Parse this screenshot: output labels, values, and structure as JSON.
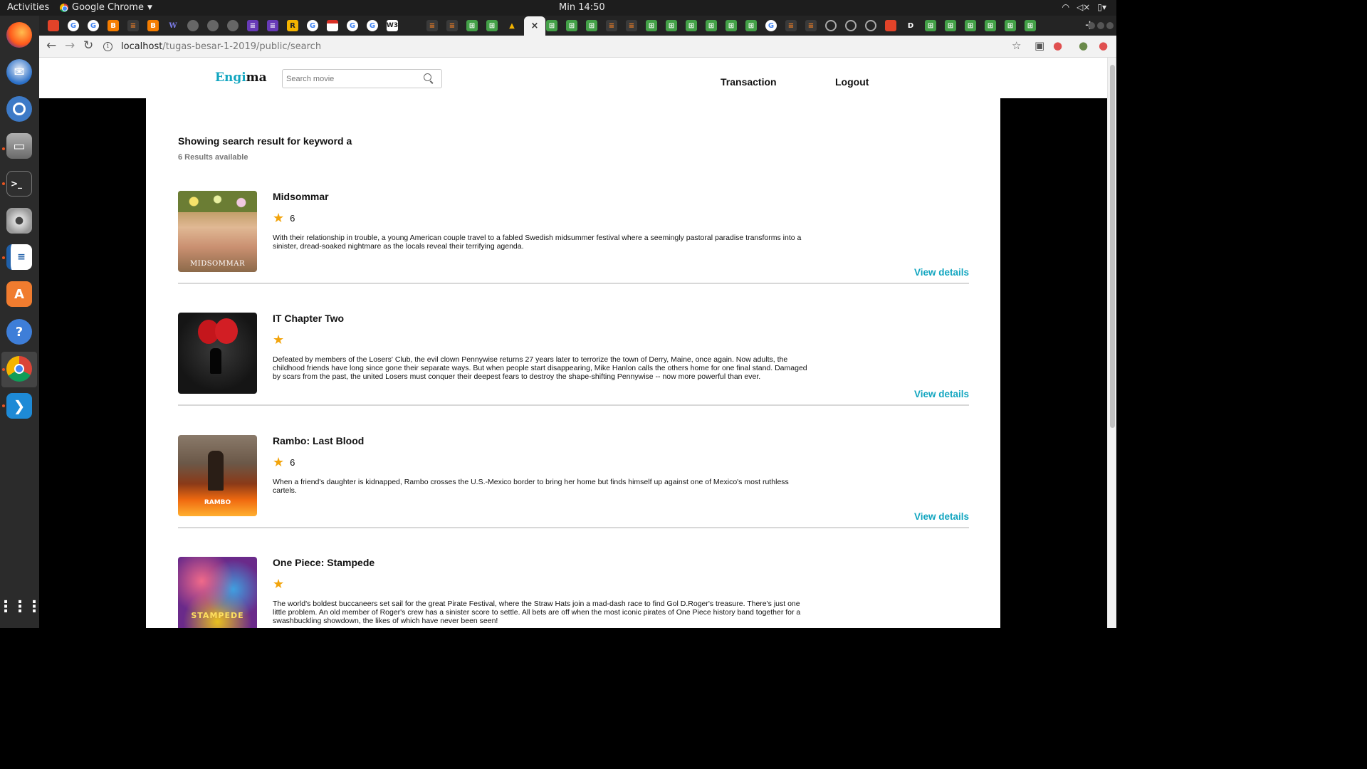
{
  "system": {
    "activities_label": "Activities",
    "app_name": "Google Chrome",
    "clock": "Min 14:50"
  },
  "browser": {
    "url_host": "localhost",
    "url_path": "/tugas-besar-1-2019/public/search",
    "tab_close_glyph": "×",
    "new_tab_glyph": "+"
  },
  "site": {
    "logo_part1": "Engi",
    "logo_part2": "ma",
    "search_placeholder": "Search movie",
    "nav": {
      "transaction": "Transaction",
      "logout": "Logout"
    },
    "accent_color": "#13a6c0",
    "star_color": "#f2a40c"
  },
  "results": {
    "title": "Showing search result for keyword a",
    "count": "6 Results available",
    "view_details_label": "View details",
    "movies": [
      {
        "title": "Midsommar",
        "rating": "6",
        "poster_text": "MIDSOMMAR",
        "description": "With their relationship in trouble, a young American couple travel to a fabled Swedish midsummer festival where a seemingly pastoral paradise transforms into a sinister, dread-soaked nightmare as the locals reveal their terrifying agenda."
      },
      {
        "title": "IT Chapter Two",
        "rating": "",
        "poster_text": "",
        "description": "Defeated by members of the Losers' Club, the evil clown Pennywise returns 27 years later to terrorize the town of Derry, Maine, once again. Now adults, the childhood friends have long since gone their separate ways. But when people start disappearing, Mike Hanlon calls the others home for one final stand. Damaged by scars from the past, the united Losers must conquer their deepest fears to destroy the shape-shifting Pennywise -- now more powerful than ever."
      },
      {
        "title": "Rambo: Last Blood",
        "rating": "6",
        "poster_text": "RAMBO",
        "description": "When a friend's daughter is kidnapped, Rambo crosses the U.S.-Mexico border to bring her home but finds himself up against one of Mexico's most ruthless cartels."
      },
      {
        "title": "One Piece: Stampede",
        "rating": "",
        "poster_text": "STAMPEDE",
        "description": "The world's boldest buccaneers set sail for the great Pirate Festival, where the Straw Hats join a mad-dash race to find Gol D.Roger's treasure. There's just one little problem. An old member of Roger's crew has a sinister score to settle. All bets are off when the most iconic pirates of One Piece history band together for a swashbuckling showdown, the likes of which have never been seen!"
      }
    ]
  }
}
